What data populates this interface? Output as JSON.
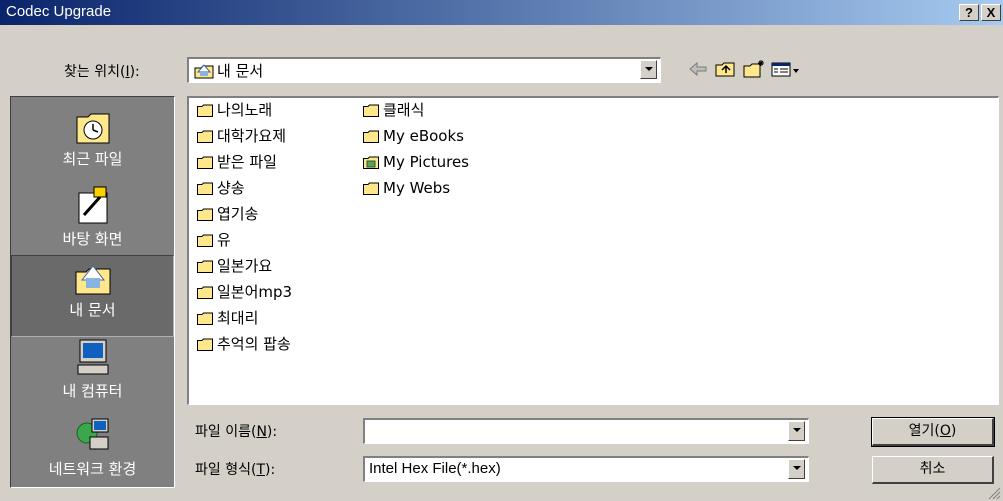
{
  "window": {
    "title": "Codec Upgrade",
    "help_label": "?",
    "close_label": "X"
  },
  "lookin": {
    "label_pre": "찾는 위치(",
    "label_key": "I",
    "label_post": "):",
    "value": "내 문서"
  },
  "places": [
    {
      "label": "최근 파일",
      "icon": "recent-files-icon"
    },
    {
      "label": "바탕 화면",
      "icon": "desktop-icon"
    },
    {
      "label": "내 문서",
      "icon": "my-documents-icon"
    },
    {
      "label": "내 컴퓨터",
      "icon": "my-computer-icon"
    },
    {
      "label": "네트워크 환경",
      "icon": "network-icon"
    }
  ],
  "files": {
    "col1": [
      "나의노래",
      "대학가요제",
      "받은 파일",
      "샹송",
      "엽기송",
      "유",
      "일본가요",
      "일본어mp3",
      "최대리",
      "추억의 팝송"
    ],
    "col2": [
      "클래식",
      "My eBooks",
      "My Pictures",
      "My Webs"
    ]
  },
  "filename": {
    "label_pre": "파일 이름(",
    "label_key": "N",
    "label_post": "):",
    "value": ""
  },
  "filetype": {
    "label_pre": "파일 형식(",
    "label_key": "T",
    "label_post": "):",
    "value": "Intel Hex File(*.hex)"
  },
  "buttons": {
    "open_pre": "열기(",
    "open_key": "O",
    "open_post": ")",
    "cancel": "취소"
  },
  "colors": {
    "title_start": "#0a246a",
    "title_end": "#a6caf0",
    "folder": "#ffe88c",
    "face": "#d4d0c8"
  }
}
